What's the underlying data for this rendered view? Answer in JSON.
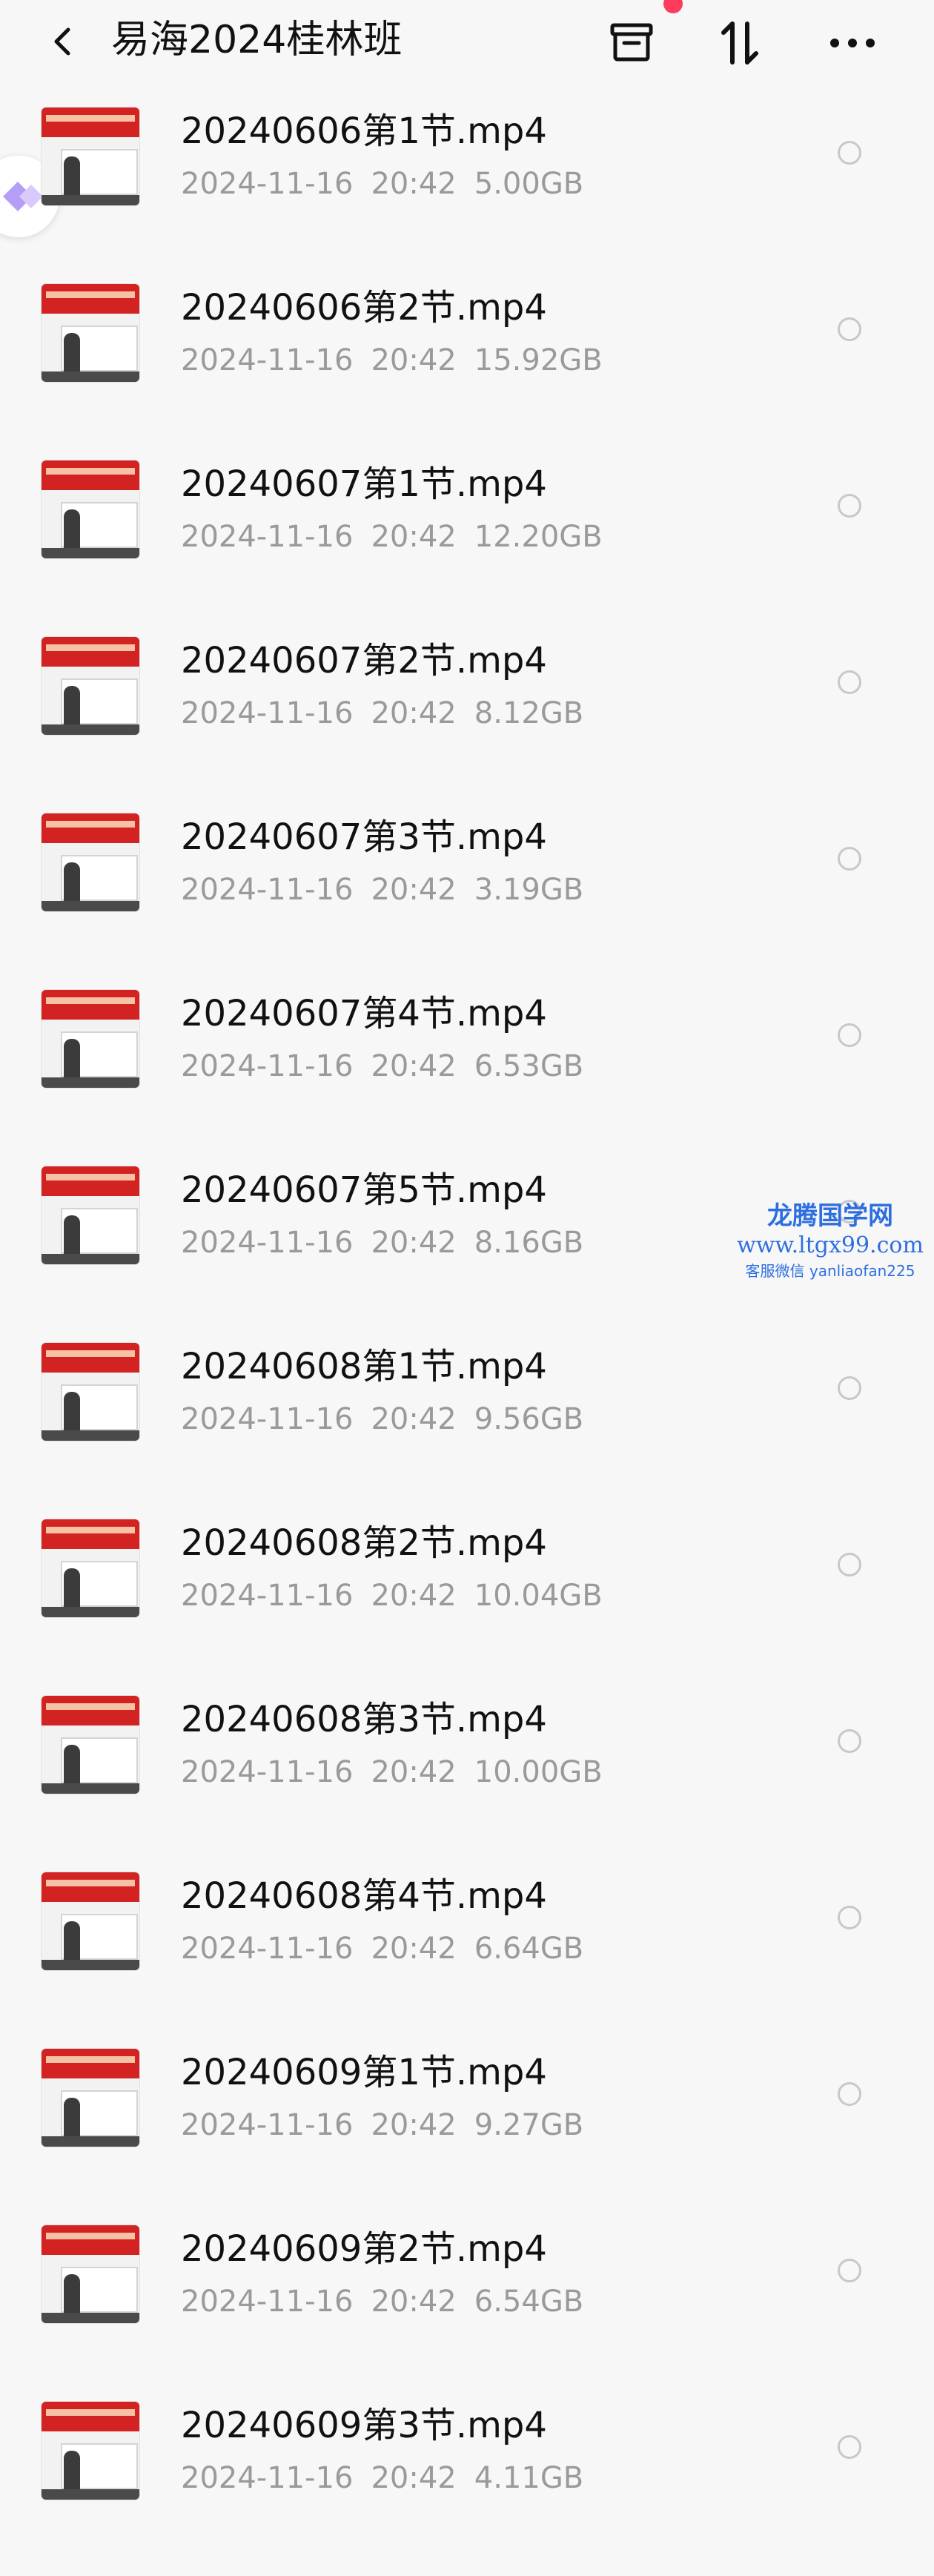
{
  "header": {
    "title": "易海2024桂林班"
  },
  "icons": {
    "back": "chevron-left-icon",
    "archive": "archive-box-icon",
    "sort": "sort-arrows-icon",
    "more": "more-dots-icon",
    "float": "diamond-arrow-icon"
  },
  "colors": {
    "background": "#f7f7f8",
    "name_text": "#111111",
    "meta_text": "#9a9a9a",
    "badge": "#ff3b5c",
    "watermark": "#2e6fe0"
  },
  "files": [
    {
      "name": "20240606第1节.mp4",
      "date": "2024-11-16",
      "time": "20:42",
      "size": "5.00GB"
    },
    {
      "name": "20240606第2节.mp4",
      "date": "2024-11-16",
      "time": "20:42",
      "size": "15.92GB"
    },
    {
      "name": "20240607第1节.mp4",
      "date": "2024-11-16",
      "time": "20:42",
      "size": "12.20GB"
    },
    {
      "name": "20240607第2节.mp4",
      "date": "2024-11-16",
      "time": "20:42",
      "size": "8.12GB"
    },
    {
      "name": "20240607第3节.mp4",
      "date": "2024-11-16",
      "time": "20:42",
      "size": "3.19GB"
    },
    {
      "name": "20240607第4节.mp4",
      "date": "2024-11-16",
      "time": "20:42",
      "size": "6.53GB"
    },
    {
      "name": "20240607第5节.mp4",
      "date": "2024-11-16",
      "time": "20:42",
      "size": "8.16GB"
    },
    {
      "name": "20240608第1节.mp4",
      "date": "2024-11-16",
      "time": "20:42",
      "size": "9.56GB"
    },
    {
      "name": "20240608第2节.mp4",
      "date": "2024-11-16",
      "time": "20:42",
      "size": "10.04GB"
    },
    {
      "name": "20240608第3节.mp4",
      "date": "2024-11-16",
      "time": "20:42",
      "size": "10.00GB"
    },
    {
      "name": "20240608第4节.mp4",
      "date": "2024-11-16",
      "time": "20:42",
      "size": "6.64GB"
    },
    {
      "name": "20240609第1节.mp4",
      "date": "2024-11-16",
      "time": "20:42",
      "size": "9.27GB"
    },
    {
      "name": "20240609第2节.mp4",
      "date": "2024-11-16",
      "time": "20:42",
      "size": "6.54GB"
    },
    {
      "name": "20240609第3节.mp4",
      "date": "2024-11-16",
      "time": "20:42",
      "size": "4.11GB"
    }
  ],
  "watermark": {
    "title": "龙腾国学网",
    "url": "www.ltgx99.com",
    "contact": "客服微信 yanliaofan225"
  }
}
